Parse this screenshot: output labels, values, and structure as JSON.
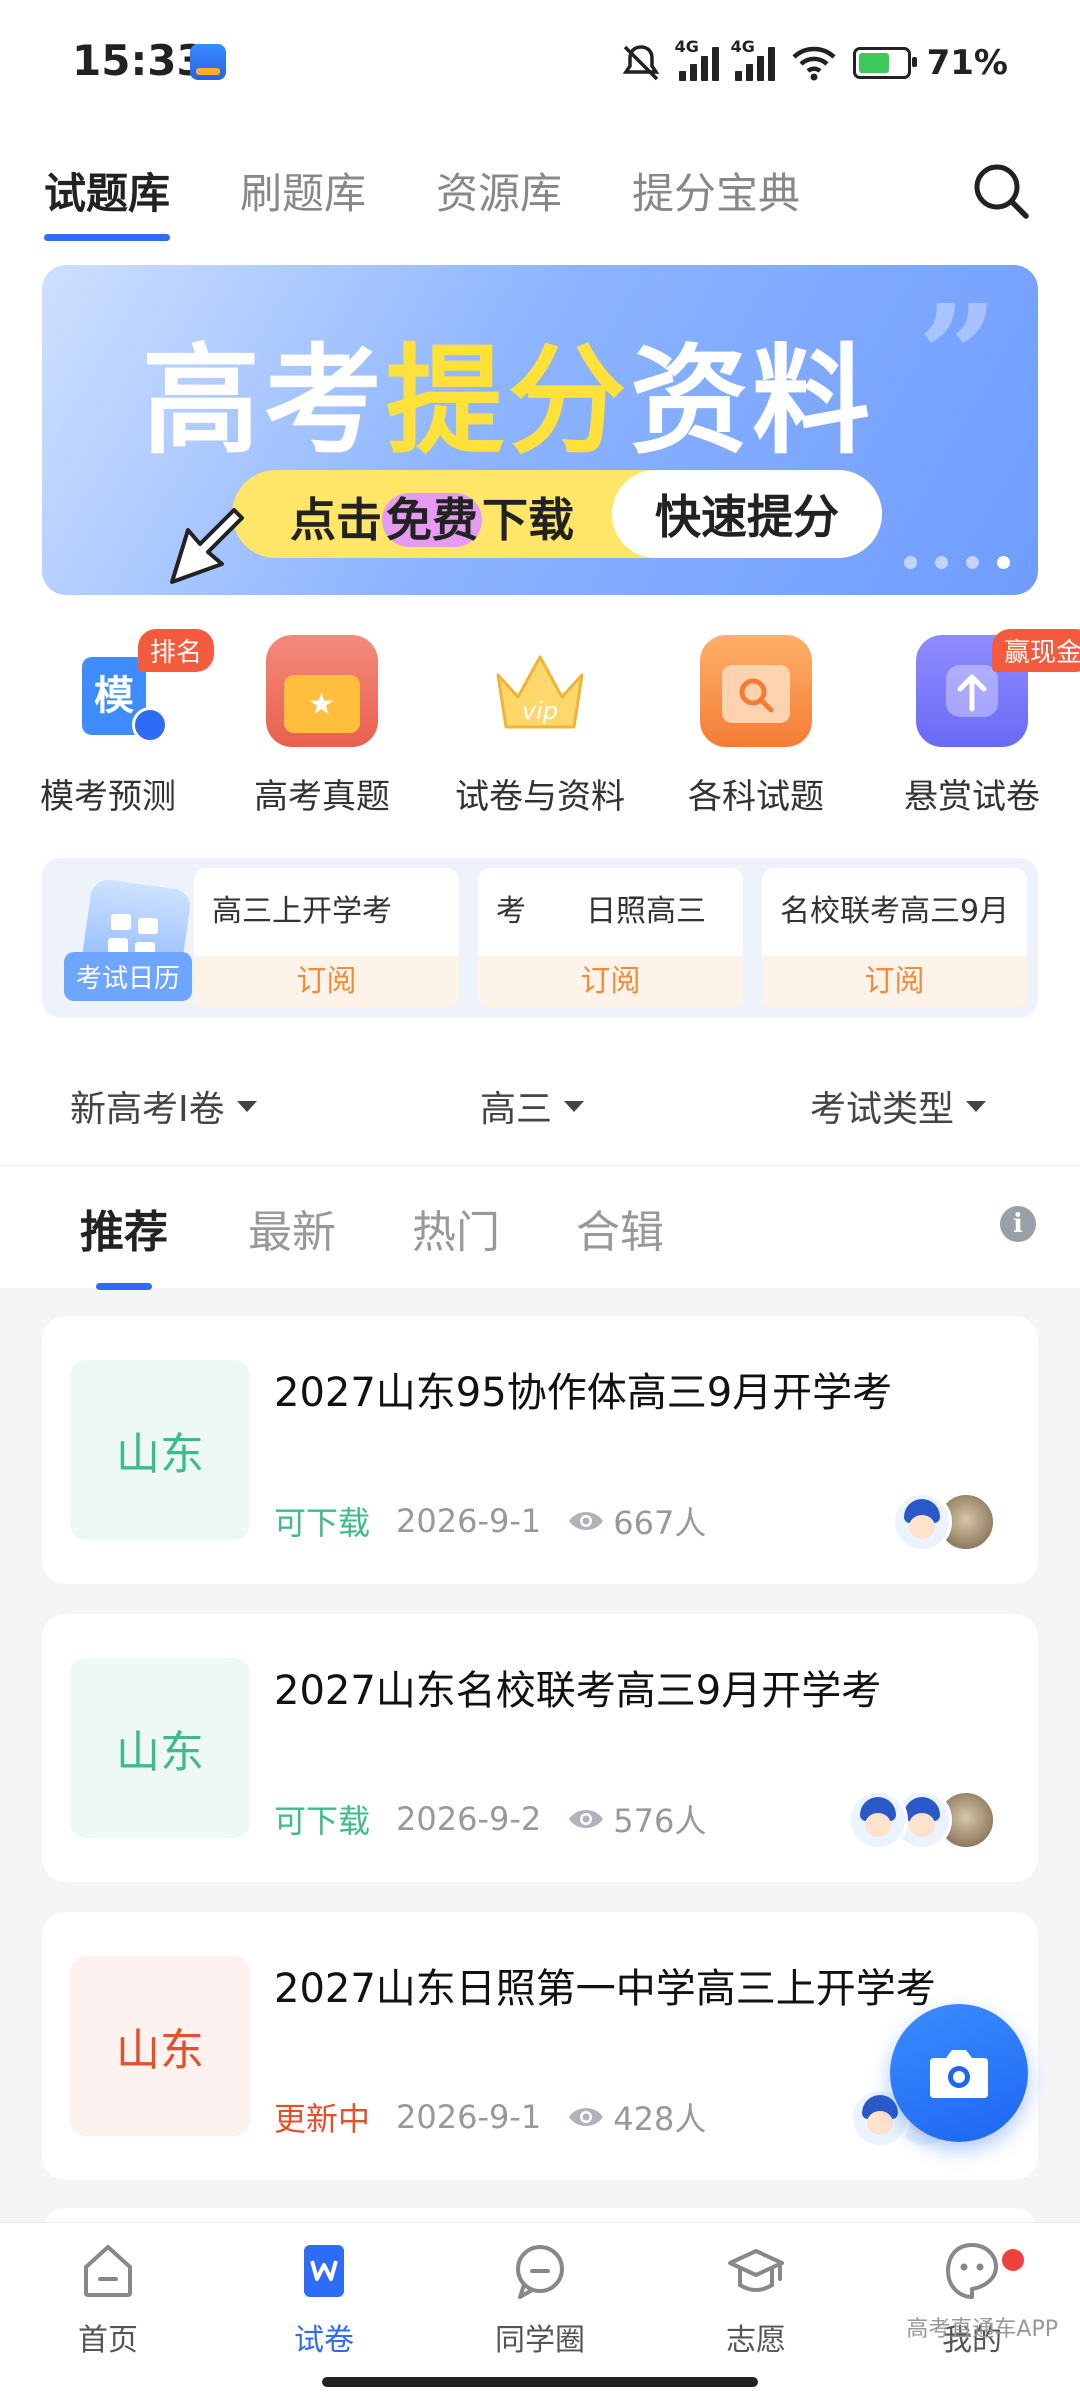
{
  "status_bar": {
    "time": "15:33",
    "network": "4G",
    "battery": "71%"
  },
  "top_tabs": [
    "试题库",
    "刷题库",
    "资源库",
    "提分宝典"
  ],
  "banner": {
    "title_part1": "高考",
    "title_part2": "提分",
    "title_part3": "资料",
    "pill_left_1": "点击",
    "pill_left_hl": "免费",
    "pill_left_2": "下载",
    "pill_right": "快速提分"
  },
  "quick_icons": [
    {
      "label": "模考预测",
      "badge": "排名",
      "icon": "mock-exam-icon"
    },
    {
      "label": "高考真题",
      "badge": "",
      "icon": "real-exam-icon"
    },
    {
      "label": "试卷与资料",
      "badge": "",
      "icon": "crown-vip-icon"
    },
    {
      "label": "各科试题",
      "badge": "",
      "icon": "search-folder-icon"
    },
    {
      "label": "悬赏试卷",
      "badge": "赢现金",
      "icon": "upload-icon"
    }
  ],
  "mock_icon_char": "模",
  "vip_text": "vip",
  "exam_calendar": {
    "label": "考试日历",
    "cards": [
      {
        "title": "高三上开学考",
        "button": "订阅"
      },
      {
        "title": "考　　日照高三",
        "button": "订阅"
      },
      {
        "title": "名校联考高三9月",
        "button": "订阅"
      }
    ]
  },
  "filters": [
    "新高考Ⅰ卷",
    "高三",
    "考试类型"
  ],
  "sub_tabs": [
    "推荐",
    "最新",
    "热门",
    "合辑"
  ],
  "info_icon_char": "i",
  "papers": [
    {
      "province": "山东",
      "title": "2027山东95协作体高三9月开学考",
      "status": "可下载",
      "date": "2026-9-1",
      "views": "667人",
      "avatars": [
        "boy",
        "cat"
      ]
    },
    {
      "province": "山东",
      "title": "2027山东名校联考高三9月开学考",
      "status": "可下载",
      "date": "2026-9-2",
      "views": "576人",
      "avatars": [
        "boy",
        "boy",
        "cat"
      ]
    },
    {
      "province": "山东",
      "title": "2027山东日照第一中学高三上开学考",
      "status": "更新中",
      "date": "2026-9-1",
      "views": "428人",
      "avatars": [
        "boy",
        "boy"
      ]
    }
  ],
  "bottom_nav": [
    "首页",
    "试卷",
    "同学圈",
    "志愿",
    "我的"
  ],
  "watermark": "高考直通车APP",
  "colors": {
    "accent": "#2f6cf6",
    "green": "#3dbb8a",
    "orange": "#e4502c",
    "badge": "#f45a3c"
  }
}
